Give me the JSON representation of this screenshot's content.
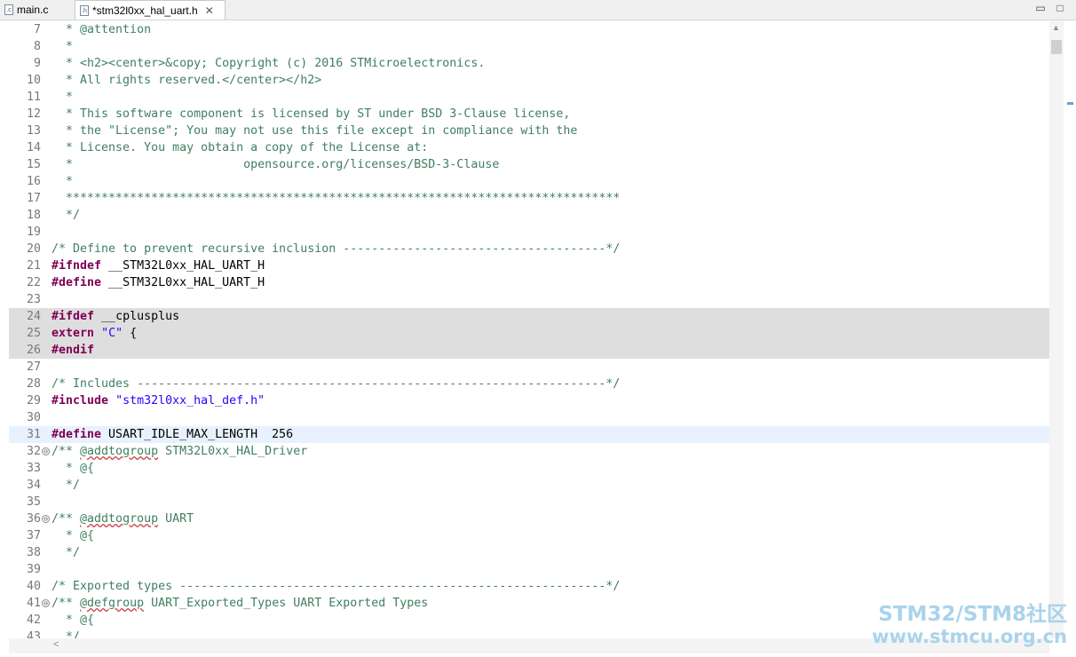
{
  "tabs": [
    {
      "label": "main.c",
      "icon": "c-file-icon",
      "icon_glyph": ".c"
    },
    {
      "label": "*stm32l0xx_hal_uart.h",
      "icon": "h-file-icon",
      "icon_glyph": ".h",
      "close": "✕"
    }
  ],
  "window_controls": {
    "minimize": "▭",
    "maximize": "□"
  },
  "lines": [
    {
      "n": "7",
      "tokens": [
        {
          "t": "  * @attention",
          "c": "comment"
        }
      ]
    },
    {
      "n": "8",
      "tokens": [
        {
          "t": "  *",
          "c": "comment"
        }
      ]
    },
    {
      "n": "9",
      "tokens": [
        {
          "t": "  * <h2><center>&copy; Copyright (c) 2016 STMicroelectronics.",
          "c": "comment"
        }
      ]
    },
    {
      "n": "10",
      "tokens": [
        {
          "t": "  * All rights reserved.</center></h2>",
          "c": "comment"
        }
      ]
    },
    {
      "n": "11",
      "tokens": [
        {
          "t": "  *",
          "c": "comment"
        }
      ]
    },
    {
      "n": "12",
      "tokens": [
        {
          "t": "  * This software component is licensed by ST under BSD 3-Clause license,",
          "c": "comment"
        }
      ]
    },
    {
      "n": "13",
      "tokens": [
        {
          "t": "  * the \"License\"; You may not use this file except in compliance with the",
          "c": "comment"
        }
      ]
    },
    {
      "n": "14",
      "tokens": [
        {
          "t": "  * License. You may obtain a copy of the License at:",
          "c": "comment"
        }
      ]
    },
    {
      "n": "15",
      "tokens": [
        {
          "t": "  *                        opensource.org/licenses/BSD-3-Clause",
          "c": "comment"
        }
      ]
    },
    {
      "n": "16",
      "tokens": [
        {
          "t": "  *",
          "c": "comment"
        }
      ]
    },
    {
      "n": "17",
      "tokens": [
        {
          "t": "  ******************************************************************************",
          "c": "comment"
        }
      ]
    },
    {
      "n": "18",
      "tokens": [
        {
          "t": "  */",
          "c": "comment"
        }
      ]
    },
    {
      "n": "19",
      "tokens": []
    },
    {
      "n": "20",
      "tokens": [
        {
          "t": "/* Define to prevent recursive inclusion -------------------------------------*/",
          "c": "comment"
        }
      ]
    },
    {
      "n": "21",
      "tokens": [
        {
          "t": "#ifndef",
          "c": "kw"
        },
        {
          "t": " __STM32L0xx_HAL_UART_H",
          "c": "plain"
        }
      ]
    },
    {
      "n": "22",
      "tokens": [
        {
          "t": "#define",
          "c": "kw"
        },
        {
          "t": " __STM32L0xx_HAL_UART_H",
          "c": "plain"
        }
      ]
    },
    {
      "n": "23",
      "tokens": []
    },
    {
      "n": "24",
      "hl": "gray",
      "tokens": [
        {
          "t": "#ifdef",
          "c": "kw"
        },
        {
          "t": " __cplusplus",
          "c": "plain"
        }
      ]
    },
    {
      "n": "25",
      "hl": "gray",
      "tokens": [
        {
          "t": "extern",
          "c": "kw"
        },
        {
          "t": " ",
          "c": "plain"
        },
        {
          "t": "\"C\"",
          "c": "str"
        },
        {
          "t": " {",
          "c": "plain"
        }
      ]
    },
    {
      "n": "26",
      "hl": "gray",
      "tokens": [
        {
          "t": "#endif",
          "c": "kw"
        }
      ]
    },
    {
      "n": "27",
      "tokens": []
    },
    {
      "n": "28",
      "tokens": [
        {
          "t": "/* Includes ------------------------------------------------------------------*/",
          "c": "comment"
        }
      ]
    },
    {
      "n": "29",
      "tokens": [
        {
          "t": "#include",
          "c": "kw"
        },
        {
          "t": " ",
          "c": "plain"
        },
        {
          "t": "\"stm32l0xx_hal_def.h\"",
          "c": "str"
        }
      ]
    },
    {
      "n": "30",
      "tokens": []
    },
    {
      "n": "31",
      "hl": "cur",
      "tokens": [
        {
          "t": "#define",
          "c": "kw"
        },
        {
          "t": " USART_IDLE_MAX_LENGTH  256",
          "c": "plain"
        }
      ]
    },
    {
      "n": "32",
      "fold": "⊖",
      "tokens": [
        {
          "t": "/** ",
          "c": "comment"
        },
        {
          "t": "@addtogroup",
          "c": "doctag"
        },
        {
          "t": " STM32L0xx_HAL_Driver",
          "c": "comment"
        }
      ]
    },
    {
      "n": "33",
      "tokens": [
        {
          "t": "  * @{",
          "c": "comment"
        }
      ]
    },
    {
      "n": "34",
      "tokens": [
        {
          "t": "  */",
          "c": "comment"
        }
      ]
    },
    {
      "n": "35",
      "tokens": []
    },
    {
      "n": "36",
      "fold": "⊖",
      "tokens": [
        {
          "t": "/** ",
          "c": "comment"
        },
        {
          "t": "@addtogroup",
          "c": "doctag"
        },
        {
          "t": " UART",
          "c": "comment"
        }
      ]
    },
    {
      "n": "37",
      "tokens": [
        {
          "t": "  * @{",
          "c": "comment"
        }
      ]
    },
    {
      "n": "38",
      "tokens": [
        {
          "t": "  */",
          "c": "comment"
        }
      ]
    },
    {
      "n": "39",
      "tokens": []
    },
    {
      "n": "40",
      "tokens": [
        {
          "t": "/* Exported types ------------------------------------------------------------*/",
          "c": "comment"
        }
      ]
    },
    {
      "n": "41",
      "fold": "⊖",
      "tokens": [
        {
          "t": "/** ",
          "c": "comment"
        },
        {
          "t": "@defgroup",
          "c": "doctag"
        },
        {
          "t": " UART_Exported_Types UART Exported Types",
          "c": "comment"
        }
      ]
    },
    {
      "n": "42",
      "tokens": [
        {
          "t": "  * @{",
          "c": "comment"
        }
      ]
    },
    {
      "n": "43",
      "tokens": [
        {
          "t": "  */",
          "c": "comment"
        }
      ]
    }
  ],
  "scroll": {
    "up_arrow": "▲",
    "left_arrow": "<"
  },
  "watermark": {
    "line1": "STM32/STM8社区",
    "line2": "www.stmcu.org.cn"
  },
  "colors": {
    "comment": "#3f7f5f",
    "keyword": "#7f0055",
    "string": "#2a00ff",
    "current_line": "#e8f2fe",
    "inactive_block": "#dedede"
  }
}
